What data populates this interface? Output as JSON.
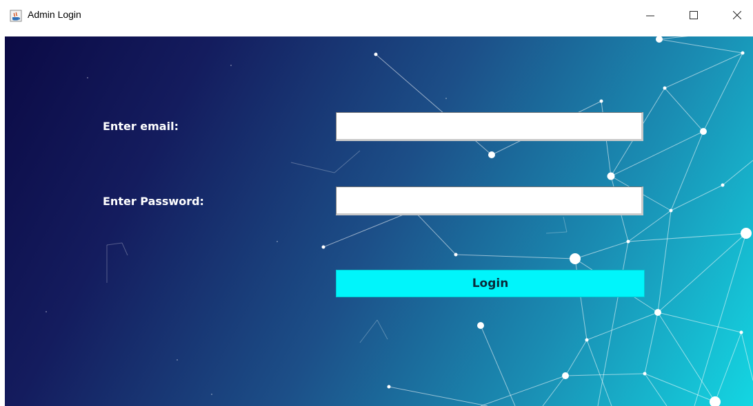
{
  "window": {
    "title": "Admin Login",
    "icon": "java-app-icon",
    "controls": [
      "minimize-icon",
      "maximize-icon",
      "close-icon"
    ]
  },
  "form": {
    "email_label": "Enter email:",
    "email_value": "",
    "password_label": "Enter Password:",
    "password_value": "",
    "login_label": "Login"
  },
  "colors": {
    "background_start": "#0b0a45",
    "background_end": "#14d6e2",
    "login_button": "#00f5fb",
    "label_text": "#ffffff"
  }
}
